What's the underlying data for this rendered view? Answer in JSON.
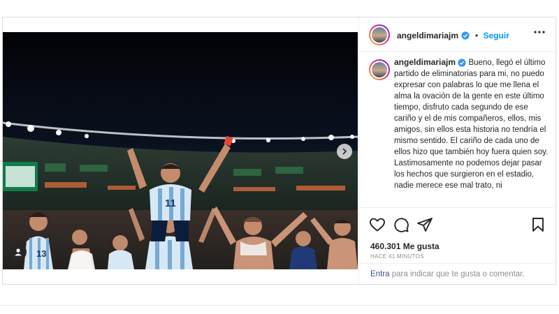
{
  "post": {
    "author": "angeldimariajm",
    "follow_label": "Seguir",
    "separator": "•",
    "caption": "Bueno, llegó el último partido de eliminatorias para mi, no puedo expresar con palabras lo que me llena el alma la ovación de la gente en este último tiempo, disfruto cada segundo de ese cariño y el de mis compañeros, ellos, mis amigos, sin ellos esta historia no tendría el mismo sentido. El cariño de cada uno de ellos hizo que también hoy fuera quien soy. Lastimosamente no podemos dejar pasar los hechos que surgieron en el estadio, nadie merece ese mal trato, ni",
    "likes": "460.301 Me gusta",
    "timestamp": "HACE 41 MINUTOS",
    "jersey_numbers": [
      "11",
      "13"
    ]
  },
  "comment": {
    "link_label": "Entra",
    "placeholder": "para indicar que te gusta o comentar."
  },
  "icons": {
    "verified": "verified-badge-icon",
    "more": "more-options-icon",
    "like": "heart-icon",
    "comment": "comment-icon",
    "share": "share-icon",
    "save": "bookmark-icon",
    "tagged_user": "user-icon",
    "next": "chevron-right-icon"
  },
  "colors": {
    "link_blue": "#0095f6",
    "verified_blue": "#3897f0",
    "comment_link": "#385185",
    "muted": "#8e8e8e"
  }
}
